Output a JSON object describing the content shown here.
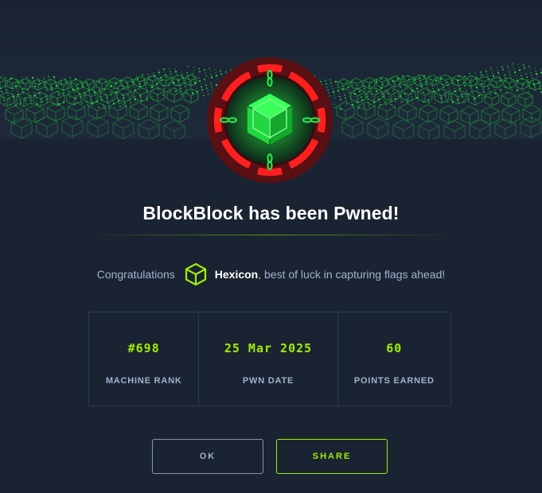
{
  "dialog": {
    "title": "BlockBlock has been Pwned!",
    "congrats_prefix": "Congratulations",
    "username": "Hexicon",
    "congrats_suffix": ", best of luck in capturing flags ahead!"
  },
  "stats": [
    {
      "value": "#698",
      "label": "MACHINE RANK"
    },
    {
      "value": "25 Mar 2025",
      "label": "PWN DATE"
    },
    {
      "value": "60",
      "label": "POINTS EARNED"
    }
  ],
  "buttons": {
    "ok_label": "OK",
    "share_label": "SHARE"
  },
  "colors": {
    "background": "#1a2332",
    "accent": "#9fef00",
    "badge_ring": "#e01b1b",
    "muted_text": "#a4b1cd"
  }
}
